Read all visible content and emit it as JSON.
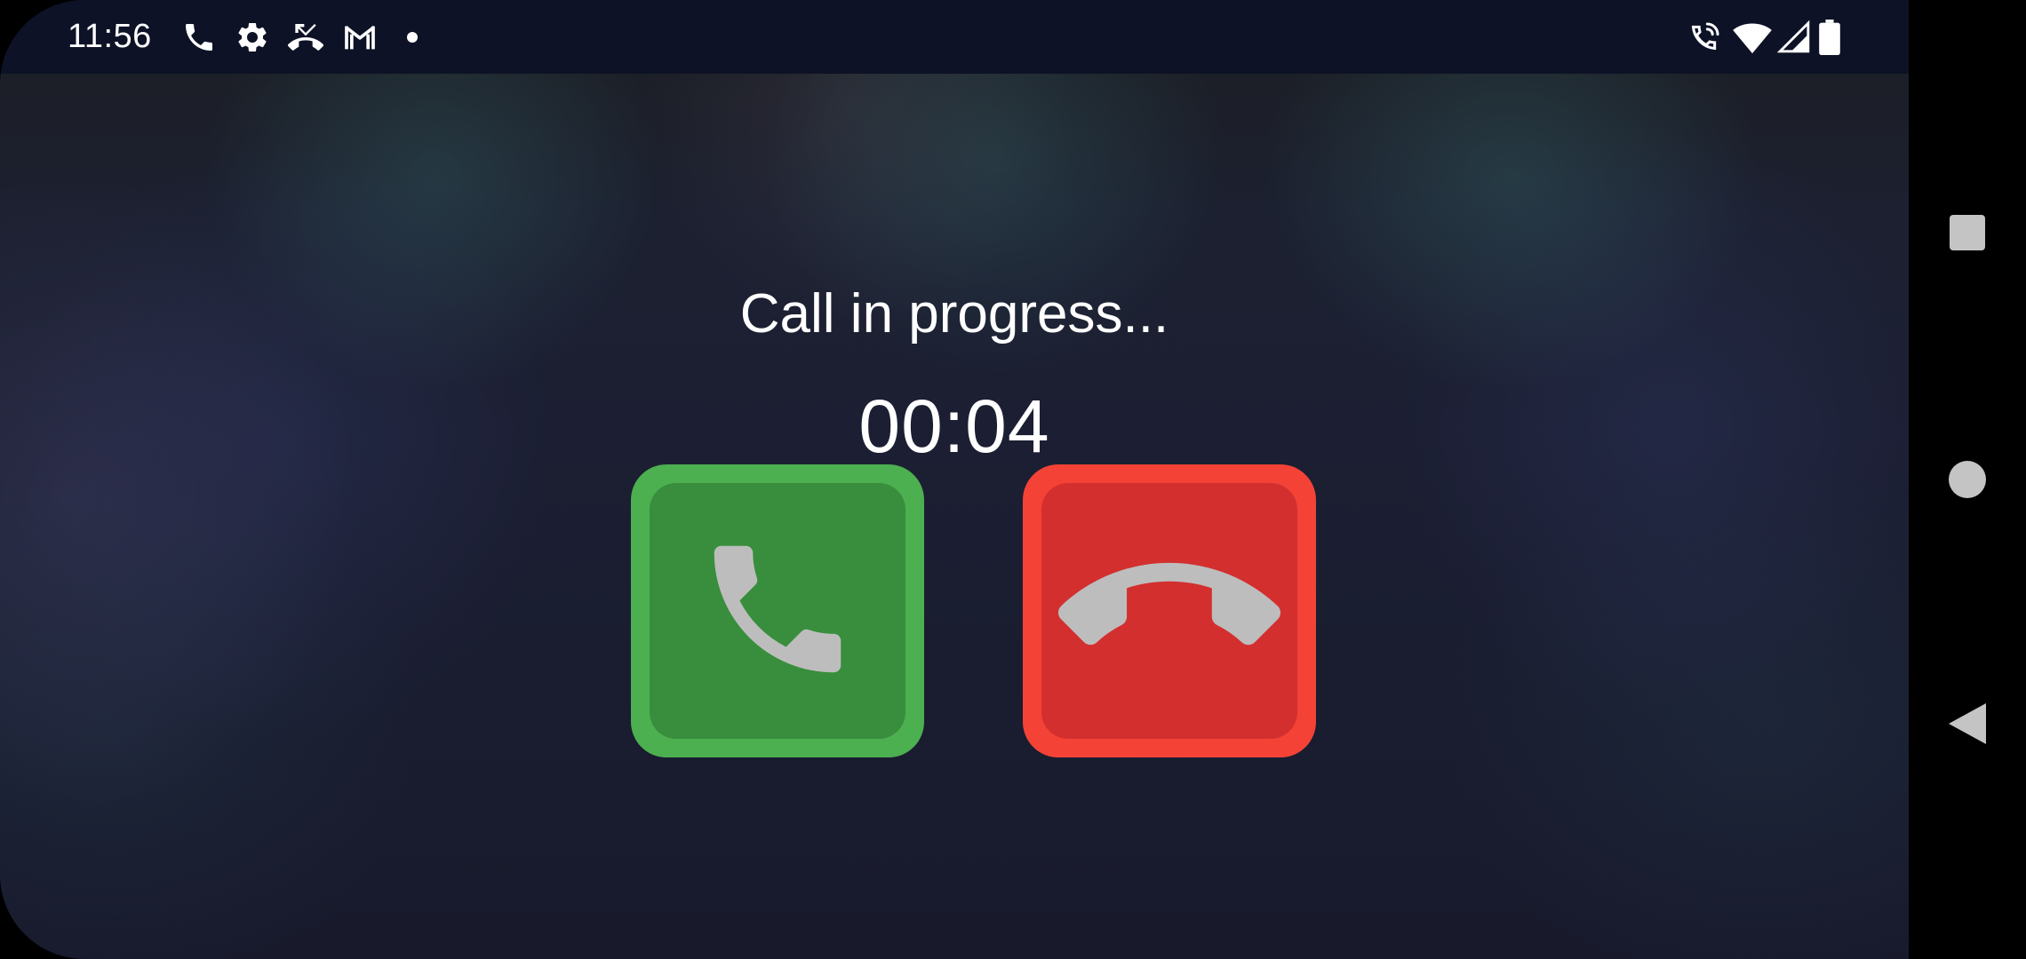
{
  "status_bar": {
    "time": "11:56",
    "left_icons": [
      "phone-icon",
      "settings-gear-icon",
      "missed-call-icon",
      "gmail-icon",
      "notification-dot-icon"
    ],
    "right_icons": [
      "ongoing-call-icon",
      "wifi-icon",
      "cell-signal-icon",
      "battery-icon"
    ]
  },
  "call": {
    "status_text": "Call in progress...",
    "timer": "00:04",
    "accept_button": {
      "icon": "phone-accept-icon",
      "color": "#4caf50",
      "inner_color": "#388e3c"
    },
    "end_button": {
      "icon": "phone-hangup-icon",
      "color": "#f44336",
      "inner_color": "#d32f2f"
    }
  },
  "nav_bar": {
    "buttons": [
      "recents-square-button",
      "home-circle-button",
      "back-triangle-button"
    ]
  }
}
